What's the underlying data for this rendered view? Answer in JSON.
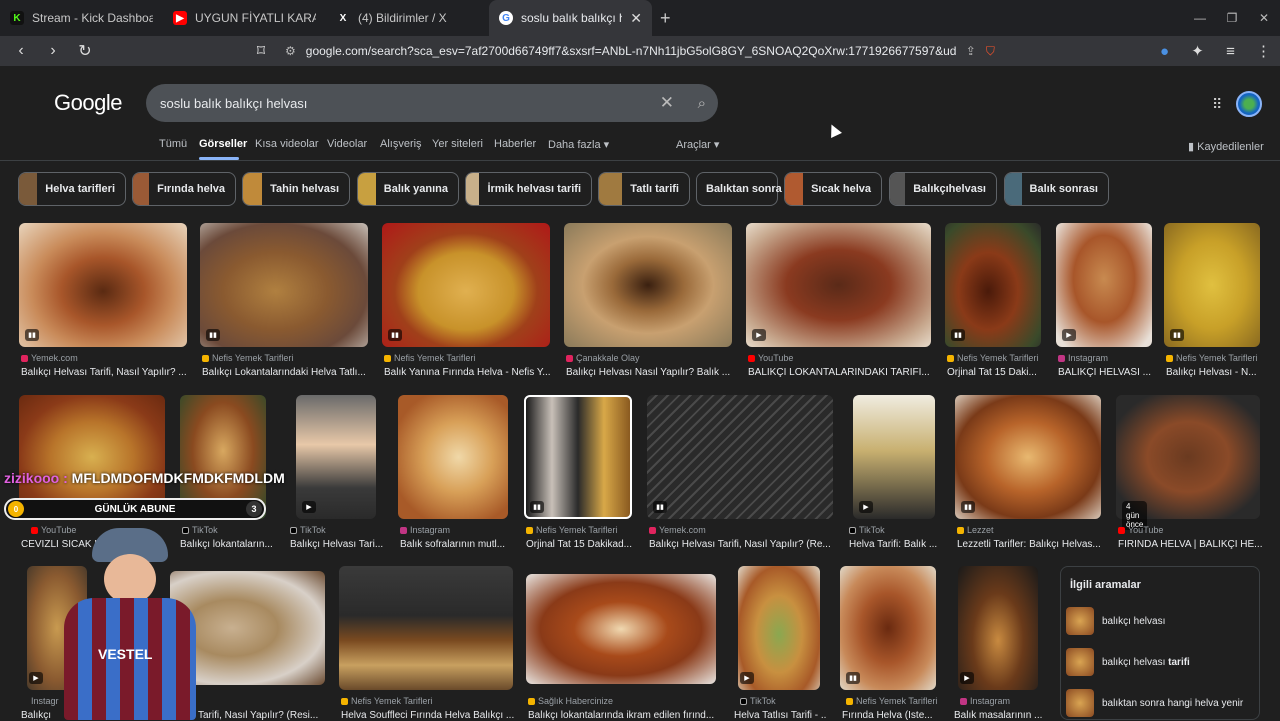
{
  "browser": {
    "tabs": [
      {
        "title": "Stream - Kick Dashboard",
        "icon": "kick-icon",
        "color": "#53fc18"
      },
      {
        "title": "UYGUN FİYATLI KARADENİZ ET LOKA",
        "icon": "youtube-icon",
        "color": "#ff0000"
      },
      {
        "title": "(4) Bildirimler / X",
        "icon": "x-icon",
        "color": "#000000"
      },
      {
        "title": "soslu balık balıkçı helvası - Go",
        "icon": "google-icon",
        "color": "#4285f4"
      }
    ],
    "new_tab": "+",
    "url": "google.com/search?sca_esv=7af2700d66749ff7&sxsrf=ANbL-n7Nh11jbG5olG8GY_6SNOAQ2QoXrw:1771926677597&udm=2&fbs=ADc_l-bgqbw..."
  },
  "google": {
    "logo": "Google",
    "query": "soslu balık balıkçı helvası",
    "tabs": [
      "Tümü",
      "Görseller",
      "Kısa videolar",
      "Videolar",
      "Alışveriş",
      "Yer siteleri",
      "Haberler",
      "Daha fazla ▾"
    ],
    "tools": "Araçlar ▾",
    "saved": "Kaydedilenler",
    "chips": [
      "Helva tarifleri",
      "Fırında helva",
      "Tahin helvası",
      "Balık yanına",
      "İrmik helvası tarifi",
      "Tatlı tarifi",
      "Balıktan sonra",
      "Sıcak helva",
      "Balıkçıhelvası",
      "Balık sonrası"
    ],
    "row1": [
      {
        "source": "Yemek.com",
        "caption": "Balıkçı Helvası Tarifi, Nasıl Yapılır? ..."
      },
      {
        "source": "Nefis Yemek Tarifleri",
        "caption": "Balıkçı Lokantalarındaki Helva Tatlı..."
      },
      {
        "source": "Nefis Yemek Tarifleri",
        "caption": "Balık Yanına Fırında Helva - Nefis Y..."
      },
      {
        "source": "Çanakkale Olay",
        "caption": "Balıkçı Helvası Nasıl Yapılır? Balık ..."
      },
      {
        "source": "YouTube",
        "caption": "BALIKÇI LOKANTALARINDAKİ TARİFİ..."
      },
      {
        "source": "Nefis Yemek Tarifleri",
        "caption": "Orjinal Tat 15 Daki..."
      },
      {
        "source": "Instagram",
        "caption": "BALIKÇI HELVASI ..."
      },
      {
        "source": "Nefis Yemek Tarifleri",
        "caption": "Balıkçı Helvası - N..."
      }
    ],
    "row2": [
      {
        "source": "YouTube",
        "caption": "CEVİZLİ SICAK HEL..."
      },
      {
        "source": "TikTok",
        "caption": "Balıkçı lokantaların..."
      },
      {
        "source": "TikTok",
        "caption": "Balıkçı Helvası Tari..."
      },
      {
        "source": "Instagram",
        "caption": "Balık sofralarının mutl..."
      },
      {
        "source": "Nefis Yemek Tarifleri",
        "caption": "Orjinal Tat 15 Dakikad..."
      },
      {
        "source": "Yemek.com",
        "caption": "Balıkçı Helvası Tarifi, Nasıl Yapılır? (Re..."
      },
      {
        "source": "TikTok",
        "caption": "Helva Tarifi: Balık ..."
      },
      {
        "source": "Lezzet",
        "caption": "Lezzetli Tarifler: Balıkçı Helvas..."
      },
      {
        "source": "YouTube",
        "caption": "FIRINDA HELVA | BALIKÇI HE..."
      }
    ],
    "row2_badge": "4 gün önce",
    "row3": [
      {
        "source": "Instagr",
        "caption": "Balıkçı"
      },
      {
        "source": "",
        "caption": "Tarifi, Nasıl Yapılır? (Resi..."
      },
      {
        "source": "Nefis Yemek Tarifleri",
        "caption": "Helva Souffleci Fırında Helva Balıkçı ..."
      },
      {
        "source": "Sağlık Habercinize",
        "caption": "Balıkçı lokantalarında ikram edilen fırınd..."
      },
      {
        "source": "TikTok",
        "caption": "Helva Tatlısı Tarifi - ..."
      },
      {
        "source": "Nefis Yemek Tarifleri",
        "caption": "Fırında Helva (İste..."
      },
      {
        "source": "Instagram",
        "caption": "Balık masalarının ..."
      }
    ],
    "related": {
      "title": "İlgili aramalar",
      "items": [
        {
          "text": "balıkçı helvası",
          "bold": ""
        },
        {
          "text": "balıkçı helvası ",
          "bold": "tarifi"
        },
        {
          "text": "balıktan sonra hangi helva yenir",
          "bold": ""
        }
      ]
    }
  },
  "stream_overlay": {
    "chat_user": "zizikooo :",
    "chat_msg": "MFLDMDOFMDKFMDKFMDLDM",
    "sub_label": "GÜNLÜK ABUNE",
    "sub_left": "0",
    "sub_right": "3",
    "shirt_text": "VESTEL"
  }
}
